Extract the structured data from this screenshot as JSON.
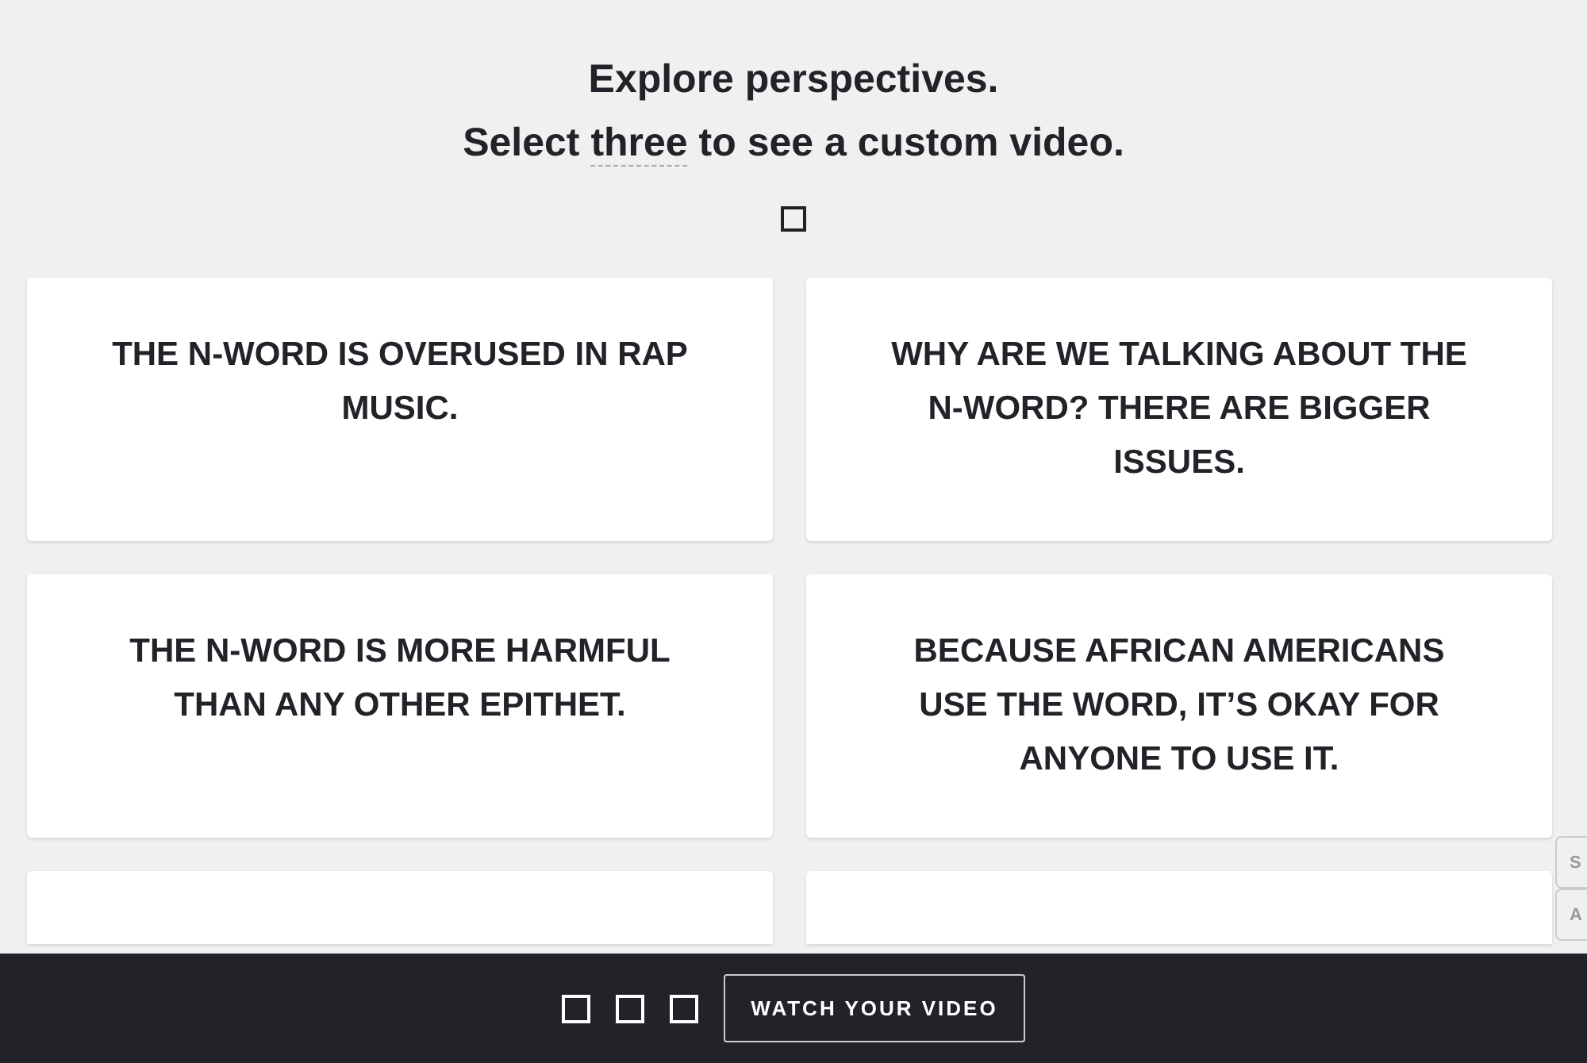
{
  "header": {
    "title": "Explore perspectives.",
    "subtitle": {
      "before": "Select ",
      "term": "three",
      "after": " to see a custom video."
    }
  },
  "cards": [
    {
      "text": "THE N-WORD IS OVERUSED IN RAP MUSIC.",
      "selected": false
    },
    {
      "text": "WHY ARE WE TALKING ABOUT THE N-WORD? THERE ARE BIGGER ISSUES.",
      "selected": false
    },
    {
      "text": "THE N-WORD IS MORE HARMFUL THAN ANY OTHER EPITHET.",
      "selected": false
    },
    {
      "text": "BECAUSE AFRICAN AMERICANS USE THE WORD, IT’S OKAY FOR ANYONE TO USE IT.",
      "selected": false
    },
    {
      "selected": false,
      "kind": "hidden"
    },
    {
      "selected": false,
      "kind": "hidden"
    }
  ],
  "side_tabs": [
    "S",
    "A"
  ],
  "bottom_bar": {
    "slots": [
      {
        "selected": false
      },
      {
        "selected": false
      },
      {
        "selected": false
      }
    ],
    "button": "WATCH YOUR VIDEO"
  }
}
